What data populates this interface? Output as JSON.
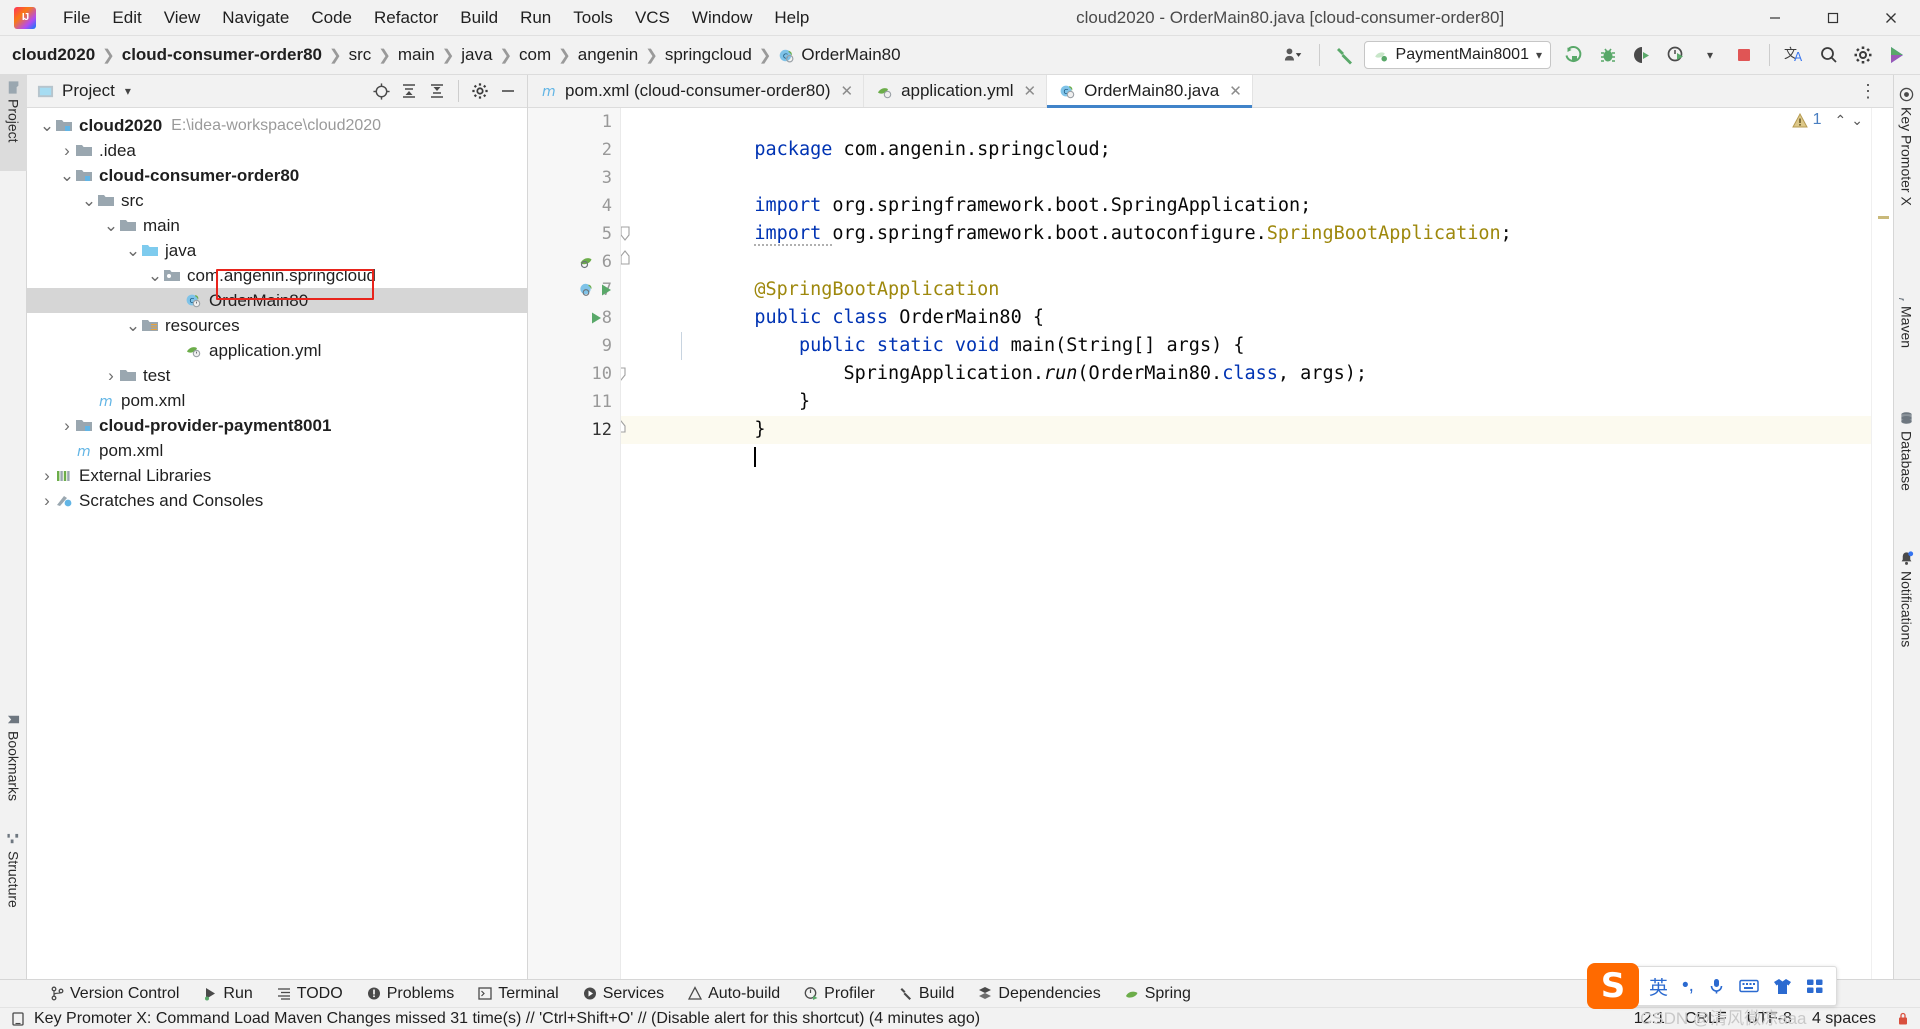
{
  "window": {
    "title": "cloud2020 - OrderMain80.java [cloud-consumer-order80]",
    "minimize": "—",
    "maximize": "▢",
    "close": "✕"
  },
  "menubar": {
    "items": [
      "File",
      "Edit",
      "View",
      "Navigate",
      "Code",
      "Refactor",
      "Build",
      "Run",
      "Tools",
      "VCS",
      "Window",
      "Help"
    ]
  },
  "breadcrumb": {
    "items": [
      {
        "label": "cloud2020",
        "bold": true
      },
      {
        "label": "cloud-consumer-order80",
        "bold": true
      },
      {
        "label": "src",
        "bold": false
      },
      {
        "label": "main",
        "bold": false
      },
      {
        "label": "java",
        "bold": false
      },
      {
        "label": "com",
        "bold": false
      },
      {
        "label": "angenin",
        "bold": false
      },
      {
        "label": "springcloud",
        "bold": false
      },
      {
        "label": "OrderMain80",
        "bold": false,
        "icon": "java-class-icon"
      }
    ],
    "separator": "❯"
  },
  "toolbar": {
    "run_config": "PaymentMain8001",
    "run_config_dropdown": "▾",
    "settings_sync_icon": "account-icon",
    "build_hammer_icon": "hammer-icon",
    "run_icon": "run-icon",
    "debug_icon": "debug-icon",
    "run_coverage_icon": "run-with-coverage-icon",
    "profiler_icon": "profiler-icon",
    "profiler_dropdown": "▾",
    "stop_icon": "stop-icon",
    "translate_icon": "translate-icon",
    "search_icon": "search-icon",
    "settings_icon": "gear-icon",
    "updates_icon": "updates-icon"
  },
  "left_tool_strip": {
    "tabs": [
      {
        "label": "Project",
        "icon": "project-folder-icon",
        "active": true
      },
      {
        "label": "Bookmarks",
        "icon": "bookmark-icon",
        "active": false
      },
      {
        "label": "Structure",
        "icon": "structure-icon",
        "active": false
      }
    ]
  },
  "right_tool_strip": {
    "tabs": [
      {
        "label": "Key Promoter X",
        "icon": "key-promoter-icon"
      },
      {
        "label": "Maven",
        "icon": "maven-icon"
      },
      {
        "label": "Database",
        "icon": "database-icon"
      },
      {
        "label": "Notifications",
        "icon": "bell-icon"
      }
    ]
  },
  "project_panel": {
    "title": "Project",
    "title_dropdown": "▾",
    "header_icons": [
      {
        "name": "select-opened-file-icon",
        "glyph": "⊕"
      },
      {
        "name": "expand-all-icon",
        "glyph": "⤓"
      },
      {
        "name": "collapse-all-icon",
        "glyph": "⤒"
      },
      {
        "name": "gear-icon",
        "glyph": "⚙"
      },
      {
        "name": "hide-icon",
        "glyph": "—"
      }
    ],
    "tree": [
      {
        "depth": 0,
        "arrow": "down",
        "icon": "module-folder-icon",
        "label": "cloud2020",
        "bold": true,
        "path": "E:\\idea-workspace\\cloud2020"
      },
      {
        "depth": 1,
        "arrow": "right",
        "icon": "folder-icon",
        "label": ".idea",
        "bold": false,
        "path": ""
      },
      {
        "depth": 1,
        "arrow": "down",
        "icon": "module-folder-icon",
        "label": "cloud-consumer-order80",
        "bold": true,
        "path": ""
      },
      {
        "depth": 2,
        "arrow": "down",
        "icon": "folder-icon",
        "label": "src",
        "bold": false,
        "path": ""
      },
      {
        "depth": 3,
        "arrow": "down",
        "icon": "folder-icon",
        "label": "main",
        "bold": false,
        "path": ""
      },
      {
        "depth": 4,
        "arrow": "down",
        "icon": "source-root-folder-icon",
        "label": "java",
        "bold": false,
        "path": ""
      },
      {
        "depth": 5,
        "arrow": "down",
        "icon": "package-icon",
        "label": "com.angenin.springcloud",
        "bold": false,
        "path": ""
      },
      {
        "depth": 6,
        "arrow": "none",
        "icon": "spring-class-icon",
        "label": "OrderMain80",
        "bold": false,
        "path": "",
        "selected": true,
        "highlighted": true
      },
      {
        "depth": 4,
        "arrow": "down",
        "icon": "resources-folder-icon",
        "label": "resources",
        "bold": false,
        "path": ""
      },
      {
        "depth": 5,
        "arrow": "none",
        "icon": "spring-yml-icon",
        "label": "application.yml",
        "bold": false,
        "path": ""
      },
      {
        "depth": 3,
        "arrow": "right",
        "icon": "folder-icon",
        "label": "test",
        "bold": false,
        "path": ""
      },
      {
        "depth": 2,
        "arrow": "none",
        "icon": "maven-m-icon",
        "label": "pom.xml",
        "bold": false,
        "path": ""
      },
      {
        "depth": 1,
        "arrow": "right",
        "icon": "module-folder-icon",
        "label": "cloud-provider-payment8001",
        "bold": true,
        "path": ""
      },
      {
        "depth": 1,
        "arrow": "none",
        "icon": "maven-m-icon",
        "label": "pom.xml",
        "bold": false,
        "path": ""
      },
      {
        "depth": 0,
        "arrow": "right",
        "icon": "external-libraries-icon",
        "label": "External Libraries",
        "bold": false,
        "path": ""
      },
      {
        "depth": 0,
        "arrow": "right",
        "icon": "scratches-icon",
        "label": "Scratches and Consoles",
        "bold": false,
        "path": ""
      }
    ]
  },
  "editor": {
    "tabs": [
      {
        "label": "pom.xml (cloud-consumer-order80)",
        "icon": "maven-m-icon",
        "active": false,
        "close": "✕"
      },
      {
        "label": "application.yml",
        "icon": "spring-yml-icon",
        "active": false,
        "close": "✕"
      },
      {
        "label": "OrderMain80.java",
        "icon": "spring-class-icon",
        "active": true,
        "close": "✕"
      }
    ],
    "more_tabs": "⋮",
    "inspection": {
      "count": "1",
      "icon": "warning-triangle-icon",
      "up": "⌃",
      "down": "⌄"
    },
    "lines": [
      {
        "n": 1,
        "tokens": [
          {
            "t": "package ",
            "c": "kw"
          },
          {
            "t": "com.angenin.springcloud;",
            "c": "plain"
          }
        ]
      },
      {
        "n": 2,
        "tokens": []
      },
      {
        "n": 3,
        "fold": "start",
        "tokens": [
          {
            "t": "import ",
            "c": "kw"
          },
          {
            "t": "org.springframework.boot.SpringApplication;",
            "c": "plain"
          }
        ]
      },
      {
        "n": 4,
        "fold": "end",
        "tokens": [
          {
            "t": "import ",
            "c": "kw"
          },
          {
            "t": "org.springframework.boot.autoconfigure.",
            "c": "plain"
          },
          {
            "t": "SpringBootApplication",
            "c": "cls"
          },
          {
            "t": ";",
            "c": "plain"
          }
        ]
      },
      {
        "n": 5,
        "tokens": []
      },
      {
        "n": 6,
        "gutter": "spring-bean-icon",
        "tokens": [
          {
            "t": "@SpringBootApplication",
            "c": "ann"
          }
        ]
      },
      {
        "n": 7,
        "gutter": "spring-run-icon",
        "tokens": [
          {
            "t": "public ",
            "c": "kw"
          },
          {
            "t": "class ",
            "c": "kw"
          },
          {
            "t": "OrderMain80 {",
            "c": "plain"
          }
        ]
      },
      {
        "n": 8,
        "gutter": "run-method-icon",
        "tokens": [
          {
            "t": "    public ",
            "c": "kw"
          },
          {
            "t": "static ",
            "c": "kw"
          },
          {
            "t": "void ",
            "c": "kw"
          },
          {
            "t": "main",
            "c": "methodc"
          },
          {
            "t": "(String[] args) {",
            "c": "plain"
          }
        ]
      },
      {
        "n": 9,
        "tokens": [
          {
            "t": "        SpringApplication.",
            "c": "plain"
          },
          {
            "t": "run",
            "c": "ital"
          },
          {
            "t": "(OrderMain80.",
            "c": "plain"
          },
          {
            "t": "class",
            "c": "kw"
          },
          {
            "t": ", args);",
            "c": "plain"
          }
        ]
      },
      {
        "n": 10,
        "tokens": [
          {
            "t": "    }",
            "c": "plain"
          }
        ]
      },
      {
        "n": 11,
        "tokens": [
          {
            "t": "}",
            "c": "plain"
          }
        ]
      },
      {
        "n": 12,
        "current": true,
        "caret": true,
        "tokens": []
      }
    ]
  },
  "bottom_toolbar": {
    "buttons": [
      {
        "label": "Version Control",
        "icon": "branch-icon"
      },
      {
        "label": "Run",
        "icon": "run-icon"
      },
      {
        "label": "TODO",
        "icon": "todo-icon"
      },
      {
        "label": "Problems",
        "icon": "problems-icon"
      },
      {
        "label": "Terminal",
        "icon": "terminal-icon"
      },
      {
        "label": "Services",
        "icon": "services-icon"
      },
      {
        "label": "Auto-build",
        "icon": "auto-build-icon"
      },
      {
        "label": "Profiler",
        "icon": "profiler-icon"
      },
      {
        "label": "Build",
        "icon": "hammer-icon"
      },
      {
        "label": "Dependencies",
        "icon": "dependencies-icon"
      },
      {
        "label": "Spring",
        "icon": "spring-leaf-icon"
      }
    ]
  },
  "status_bar": {
    "message_icon": "key-promoter-notification-icon",
    "message": "Key Promoter X: Command Load Maven Changes missed 31 time(s) // 'Ctrl+Shift+O' // (Disable alert for this shortcut) (4 minutes ago)",
    "caret_position": "12:1",
    "line_separator": "CRLF",
    "encoding": "UTF-8",
    "indent": "4 spaces",
    "lock_icon": "lock-icon"
  },
  "ime_popup": {
    "logo": "S",
    "items": [
      "英",
      "•,",
      "mic-icon",
      "keyboard-icon",
      "skin-icon",
      "apps-icon"
    ]
  },
  "watermark": "CSDN @清风微凉aaa",
  "colors": {
    "accent_blue": "#4083c9",
    "keyword": "#0033b3",
    "annotation": "#9e880d",
    "highlight_red": "#e8241c",
    "panel_bg": "#f2f2f2",
    "selection_gray": "#d6d6d6",
    "current_line": "#fcfaef"
  }
}
